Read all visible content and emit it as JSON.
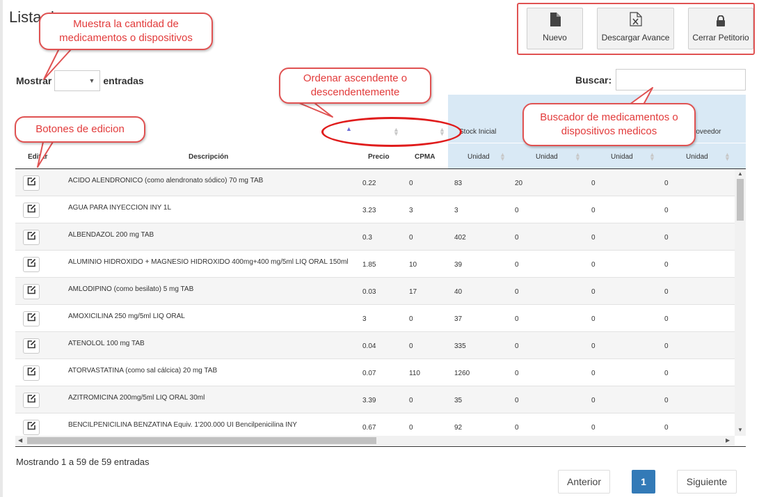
{
  "page_title": "Lista de ",
  "toolbar": {
    "new_label": "Nuevo",
    "download_label": "Descargar Avance",
    "close_label": "Cerrar Petitorio"
  },
  "length_control": {
    "label_before": "Mostrar",
    "label_after": "entradas",
    "selected": ""
  },
  "search": {
    "label": "Buscar:",
    "value": ""
  },
  "headers": {
    "editar": "Editar",
    "descripcion": "Descripción",
    "precio": "Precio",
    "cpma": "CPMA",
    "stock_inicial": "Stock Inicial",
    "proveedor": "roveedor",
    "unidad": "Unidad"
  },
  "rows": [
    {
      "descripcion": "ACIDO ALENDRONICO (como alendronato sódico) 70 mg TAB",
      "precio": "0.22",
      "cpma": "0",
      "stock": "83",
      "c5": "20",
      "c6": "0",
      "c7": "0"
    },
    {
      "descripcion": "AGUA PARA INYECCION INY 1L",
      "precio": "3.23",
      "cpma": "3",
      "stock": "3",
      "c5": "0",
      "c6": "0",
      "c7": "0"
    },
    {
      "descripcion": "ALBENDAZOL 200 mg TAB",
      "precio": "0.3",
      "cpma": "0",
      "stock": "402",
      "c5": "0",
      "c6": "0",
      "c7": "0"
    },
    {
      "descripcion": "ALUMINIO HIDROXIDO + MAGNESIO HIDROXIDO 400mg+400 mg/5ml LIQ ORAL 150ml",
      "precio": "1.85",
      "cpma": "10",
      "stock": "39",
      "c5": "0",
      "c6": "0",
      "c7": "0"
    },
    {
      "descripcion": "AMLODIPINO (como besilato) 5 mg TAB",
      "precio": "0.03",
      "cpma": "17",
      "stock": "40",
      "c5": "0",
      "c6": "0",
      "c7": "0"
    },
    {
      "descripcion": "AMOXICILINA 250 mg/5ml LIQ ORAL",
      "precio": "3",
      "cpma": "0",
      "stock": "37",
      "c5": "0",
      "c6": "0",
      "c7": "0"
    },
    {
      "descripcion": "ATENOLOL 100 mg TAB",
      "precio": "0.04",
      "cpma": "0",
      "stock": "335",
      "c5": "0",
      "c6": "0",
      "c7": "0"
    },
    {
      "descripcion": "ATORVASTATINA (como sal cálcica) 20 mg TAB",
      "precio": "0.07",
      "cpma": "110",
      "stock": "1260",
      "c5": "0",
      "c6": "0",
      "c7": "0"
    },
    {
      "descripcion": "AZITROMICINA 200mg/5ml LIQ ORAL 30ml",
      "precio": "3.39",
      "cpma": "0",
      "stock": "35",
      "c5": "0",
      "c6": "0",
      "c7": "0"
    },
    {
      "descripcion": "BENCILPENICILINA BENZATINA Equiv. 1'200.000 UI Bencilpenicilina INY",
      "precio": "0.67",
      "cpma": "0",
      "stock": "92",
      "c5": "0",
      "c6": "0",
      "c7": "0"
    }
  ],
  "info_text": "Mostrando 1 a 59 de 59 entradas",
  "pagination": {
    "prev": "Anterior",
    "current": "1",
    "next": "Siguiente"
  },
  "annotations": {
    "count_note": "Muestra la cantidad de medicamentos o dispositivos",
    "sort_note": "Ordenar ascendente o descendentemente",
    "edit_note": "Botones de edicion",
    "search_note": "Buscador de medicamentos o dispositivos medicos"
  },
  "colors": {
    "annotation": "#e05252",
    "header_band": "#d9e9f5",
    "active_page": "#337ab7",
    "sort_active": "#6b6bd6"
  },
  "icons": {
    "new": "file-icon",
    "download": "excel-file-icon",
    "close": "lock-icon",
    "edit": "edit-icon"
  }
}
